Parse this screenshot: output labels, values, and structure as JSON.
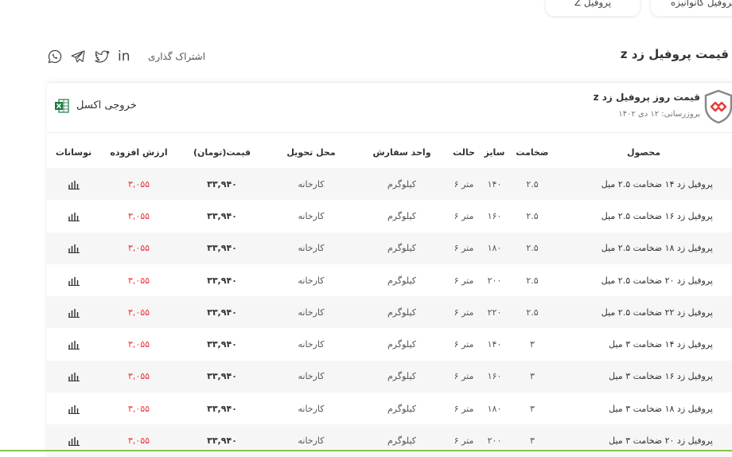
{
  "top_tabs": [
    "پروفیل Z",
    "پروفیل کانوانیزه"
  ],
  "page": {
    "title": "قیمت پروفیل زد z",
    "share_label": "اشتراک گذاری",
    "social_icons": [
      "whatsapp-icon",
      "telegram-icon",
      "twitter-icon",
      "linkedin-icon"
    ]
  },
  "card": {
    "title": "قیمت روز پروفیل زد z",
    "updated": "بروزرسانی: ۱۲ دی ۱۴۰۲",
    "excel_label": "خروجی اکسل"
  },
  "table": {
    "headers": {
      "product": "محصول",
      "thickness": "ضخامت",
      "size": "سایز",
      "state": "حالت",
      "unit": "واحد سفارش",
      "delivery": "محل تحویل",
      "price": "قیمت(تومان)",
      "tax": "ارزش افزوده",
      "chart": "نوسانات"
    },
    "rows": [
      {
        "product": "پروفیل زد ۱۴ ضخامت ۲.۵ میل",
        "thickness": "۲.۵",
        "size": "۱۴۰",
        "state": "۶ متر",
        "unit": "کیلوگرم",
        "delivery": "کارخانه",
        "price": "۳۳,۹۴۰",
        "tax": "۳,۰۵۵"
      },
      {
        "product": "پروفیل زد ۱۶ ضخامت ۲.۵ میل",
        "thickness": "۲.۵",
        "size": "۱۶۰",
        "state": "۶ متر",
        "unit": "کیلوگرم",
        "delivery": "کارخانه",
        "price": "۳۳,۹۴۰",
        "tax": "۳,۰۵۵"
      },
      {
        "product": "پروفیل زد ۱۸ ضخامت ۲.۵ میل",
        "thickness": "۲.۵",
        "size": "۱۸۰",
        "state": "۶ متر",
        "unit": "کیلوگرم",
        "delivery": "کارخانه",
        "price": "۳۳,۹۴۰",
        "tax": "۳,۰۵۵"
      },
      {
        "product": "پروفیل زد ۲۰ ضخامت ۲.۵ میل",
        "thickness": "۲.۵",
        "size": "۲۰۰",
        "state": "۶ متر",
        "unit": "کیلوگرم",
        "delivery": "کارخانه",
        "price": "۳۳,۹۴۰",
        "tax": "۳,۰۵۵"
      },
      {
        "product": "پروفیل زد ۲۲ ضخامت ۲.۵ میل",
        "thickness": "۲.۵",
        "size": "۲۲۰",
        "state": "۶ متر",
        "unit": "کیلوگرم",
        "delivery": "کارخانه",
        "price": "۳۳,۹۴۰",
        "tax": "۳,۰۵۵"
      },
      {
        "product": "پروفیل زد ۱۴ ضخامت ۳ میل",
        "thickness": "۳",
        "size": "۱۴۰",
        "state": "۶ متر",
        "unit": "کیلوگرم",
        "delivery": "کارخانه",
        "price": "۳۳,۹۴۰",
        "tax": "۳,۰۵۵"
      },
      {
        "product": "پروفیل زد ۱۶ ضخامت ۳ میل",
        "thickness": "۳",
        "size": "۱۶۰",
        "state": "۶ متر",
        "unit": "کیلوگرم",
        "delivery": "کارخانه",
        "price": "۳۳,۹۴۰",
        "tax": "۳,۰۵۵"
      },
      {
        "product": "پروفیل زد ۱۸ ضخامت ۳ میل",
        "thickness": "۳",
        "size": "۱۸۰",
        "state": "۶ متر",
        "unit": "کیلوگرم",
        "delivery": "کارخانه",
        "price": "۳۳,۹۴۰",
        "tax": "۳,۰۵۵"
      },
      {
        "product": "پروفیل زد ۲۰ ضخامت ۳ میل",
        "thickness": "۳",
        "size": "۲۰۰",
        "state": "۶ متر",
        "unit": "کیلوگرم",
        "delivery": "کارخانه",
        "price": "۳۳,۹۴۰",
        "tax": "۳,۰۵۵"
      }
    ]
  },
  "colors": {
    "tax": "#e53935",
    "accent_green": "#8bc34a",
    "logo_red": "#e53935"
  }
}
